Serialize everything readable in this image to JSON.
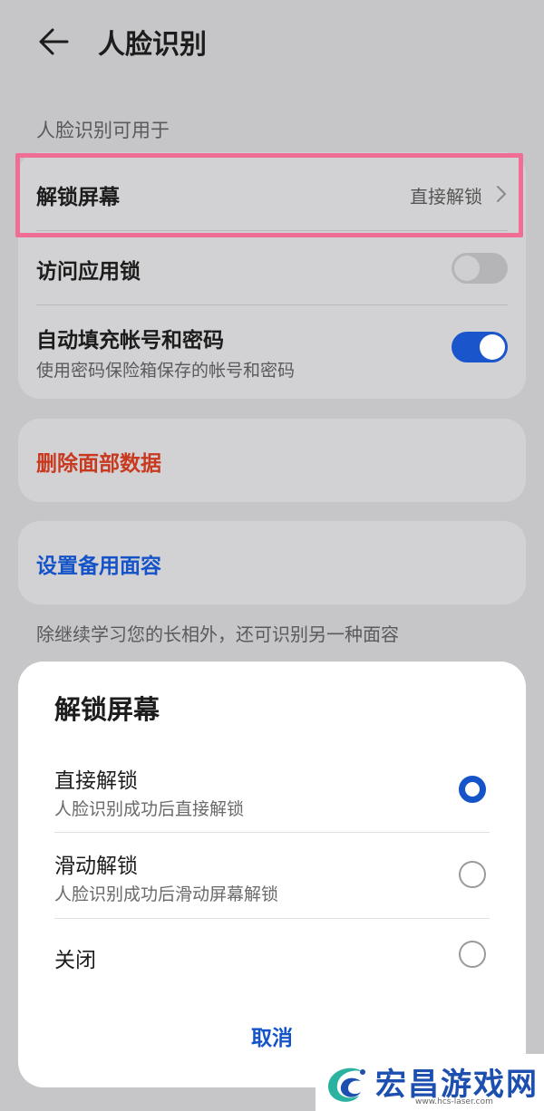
{
  "header": {
    "title": "人脸识别",
    "back_icon": "back-arrow-icon"
  },
  "section_label": "人脸识别可用于",
  "settings": {
    "unlock_screen": {
      "label": "解锁屏幕",
      "value": "直接解锁"
    },
    "app_lock": {
      "label": "访问应用锁",
      "enabled": false
    },
    "autofill": {
      "label": "自动填充帐号和密码",
      "sublabel": "使用密码保险箱保存的帐号和密码",
      "enabled": true
    }
  },
  "delete_face_data": "删除面部数据",
  "alternate_face": "设置备用面容",
  "alternate_face_note": "除继续学习您的长相外，还可识别另一种面容",
  "sheet": {
    "title": "解锁屏幕",
    "options": [
      {
        "label": "直接解锁",
        "sublabel": "人脸识别成功后直接解锁",
        "selected": true
      },
      {
        "label": "滑动解锁",
        "sublabel": "人脸识别成功后滑动屏幕解锁",
        "selected": false
      },
      {
        "label": "关闭",
        "sublabel": "",
        "selected": false
      }
    ],
    "cancel_label": "取消"
  },
  "watermark": {
    "name": "宏昌游戏网",
    "url": "www.hcs-laser.com"
  },
  "colors": {
    "accent": "#1453c8",
    "danger": "#c8391f",
    "highlight": "#f06d96",
    "background": "#c6c6c8"
  }
}
